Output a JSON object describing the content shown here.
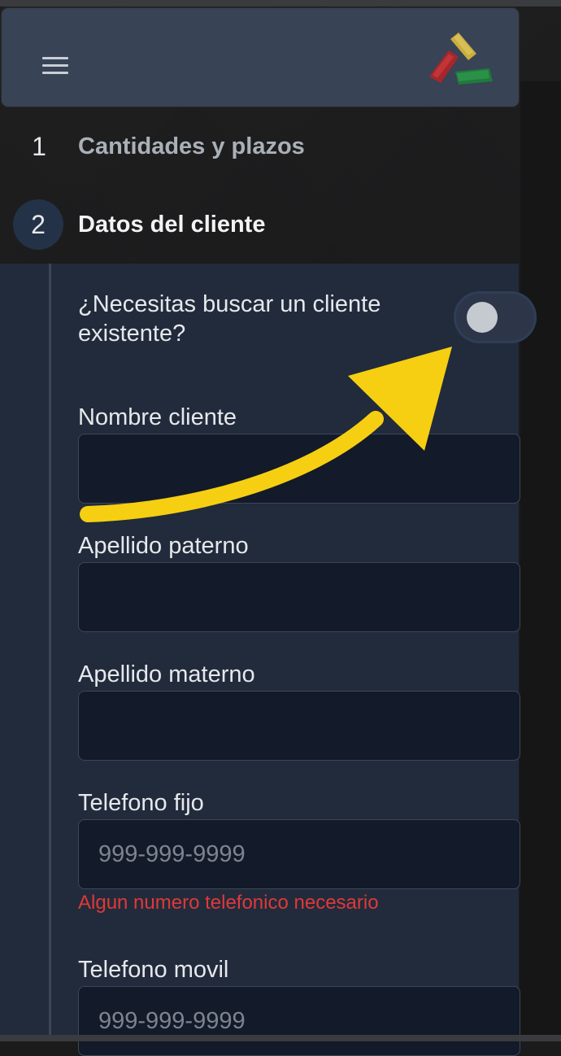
{
  "header": {
    "menu_icon": "hamburger-menu-icon",
    "logo_icon": "company-logo-icon"
  },
  "steps": [
    {
      "number": "1",
      "label": "Cantidades y plazos",
      "state": "inactive"
    },
    {
      "number": "2",
      "label": "Datos del cliente",
      "state": "active"
    }
  ],
  "form": {
    "search_question": "¿Necesitas buscar un cliente existente?",
    "search_toggle_on": false,
    "fields": [
      {
        "label": "Nombre cliente",
        "value": "",
        "placeholder": ""
      },
      {
        "label": "Apellido paterno",
        "value": "",
        "placeholder": ""
      },
      {
        "label": "Apellido materno",
        "value": "",
        "placeholder": ""
      },
      {
        "label": "Telefono fijo",
        "value": "",
        "placeholder": "999-999-9999"
      },
      {
        "label": "Telefono movil",
        "value": "",
        "placeholder": "999-999-9999"
      }
    ],
    "phone_error": "Algun numero telefonico necesario"
  },
  "colors": {
    "header_bg": "#384355",
    "panel_bg": "#212b3b",
    "input_bg": "#131a29",
    "error": "#e0383a",
    "annotation_arrow": "#f6cf12"
  }
}
